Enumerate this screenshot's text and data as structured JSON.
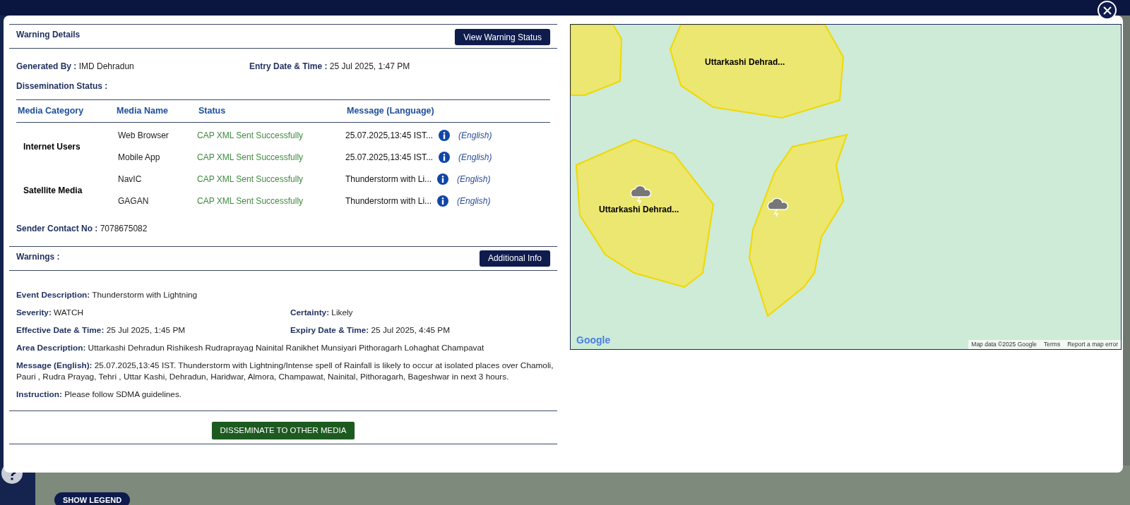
{
  "warning_details": {
    "title": "Warning Details",
    "button": "View Warning Status",
    "fields": [
      {
        "label": "Generated By :",
        "value": "IMD Dehradun"
      },
      {
        "label": "Entry Date & Time :",
        "value": "25 Jul 2025, 1:47 PM"
      }
    ],
    "dissemination_label": "Dissemination Status :",
    "table": {
      "columns": [
        "Media Category",
        "Media Name",
        "Status",
        "Message (Language)"
      ],
      "groups": [
        {
          "category": "Internet Users",
          "rows": [
            {
              "media_name": "Web Browser",
              "status": "CAP XML Sent Successfully",
              "message": "25.07.2025,13:45 IST...",
              "language": "(English)"
            },
            {
              "media_name": "Mobile App",
              "status": "CAP XML Sent Successfully",
              "message": "25.07.2025,13:45 IST...",
              "language": "(English)"
            }
          ]
        },
        {
          "category": "Satellite Media",
          "rows": [
            {
              "media_name": "NavIC",
              "status": "CAP XML Sent Successfully",
              "message": "Thunderstorm with Li...",
              "language": "(English)"
            },
            {
              "media_name": "GAGAN",
              "status": "CAP XML Sent Successfully",
              "message": "Thunderstorm with Li...",
              "language": "(English)"
            }
          ]
        }
      ]
    },
    "sender": {
      "label": "Sender Contact No :",
      "value": "7078675082"
    }
  },
  "warnings": {
    "title": "Warnings :",
    "button": "Additional Info",
    "rows": [
      [
        {
          "label": "Event Description:",
          "value": "Thunderstorm with Lightning"
        }
      ],
      [
        {
          "label": "Severity:",
          "value": "WATCH"
        },
        {
          "label": "Certainty:",
          "value": "Likely"
        }
      ],
      [
        {
          "label": "Effective Date & Time:",
          "value": "25 Jul 2025, 1:45 PM"
        },
        {
          "label": "Expiry Date & Time:",
          "value": "25 Jul 2025, 4:45 PM"
        }
      ],
      [
        {
          "label": "Area Description:",
          "value": "Uttarkashi Dehradun Rishikesh Rudraprayag Nainital Ranikhet Munsiyari Pithoragarh Lohaghat Champavat"
        }
      ],
      [
        {
          "label": "Message (English):",
          "value": "25.07.2025,13:45 IST. Thunderstorm with Lightning/Intense spell of Rainfall is likely to occur at isolated places over Chamoli, Pauri , Rudra Prayag, Tehri , Uttar Kashi, Dehradun, Haridwar, Almora, Champawat, Nainital, Pithoragarh, Bageshwar in next 3 hours."
        }
      ],
      [
        {
          "label": "Instruction:",
          "value": "Please follow SDMA guidelines."
        }
      ]
    ]
  },
  "disseminate_button": "DISSEMINATE TO OTHER MEDIA",
  "map": {
    "area_labels": [
      "Uttarkashi Dehrad...",
      "Uttarkashi Dehrad..."
    ],
    "logo": "Google",
    "attribution": [
      "Map data ©2025 Google",
      "Terms",
      "Report a map error"
    ]
  },
  "background": {
    "legend_button": "SHOW LEGEND"
  }
}
